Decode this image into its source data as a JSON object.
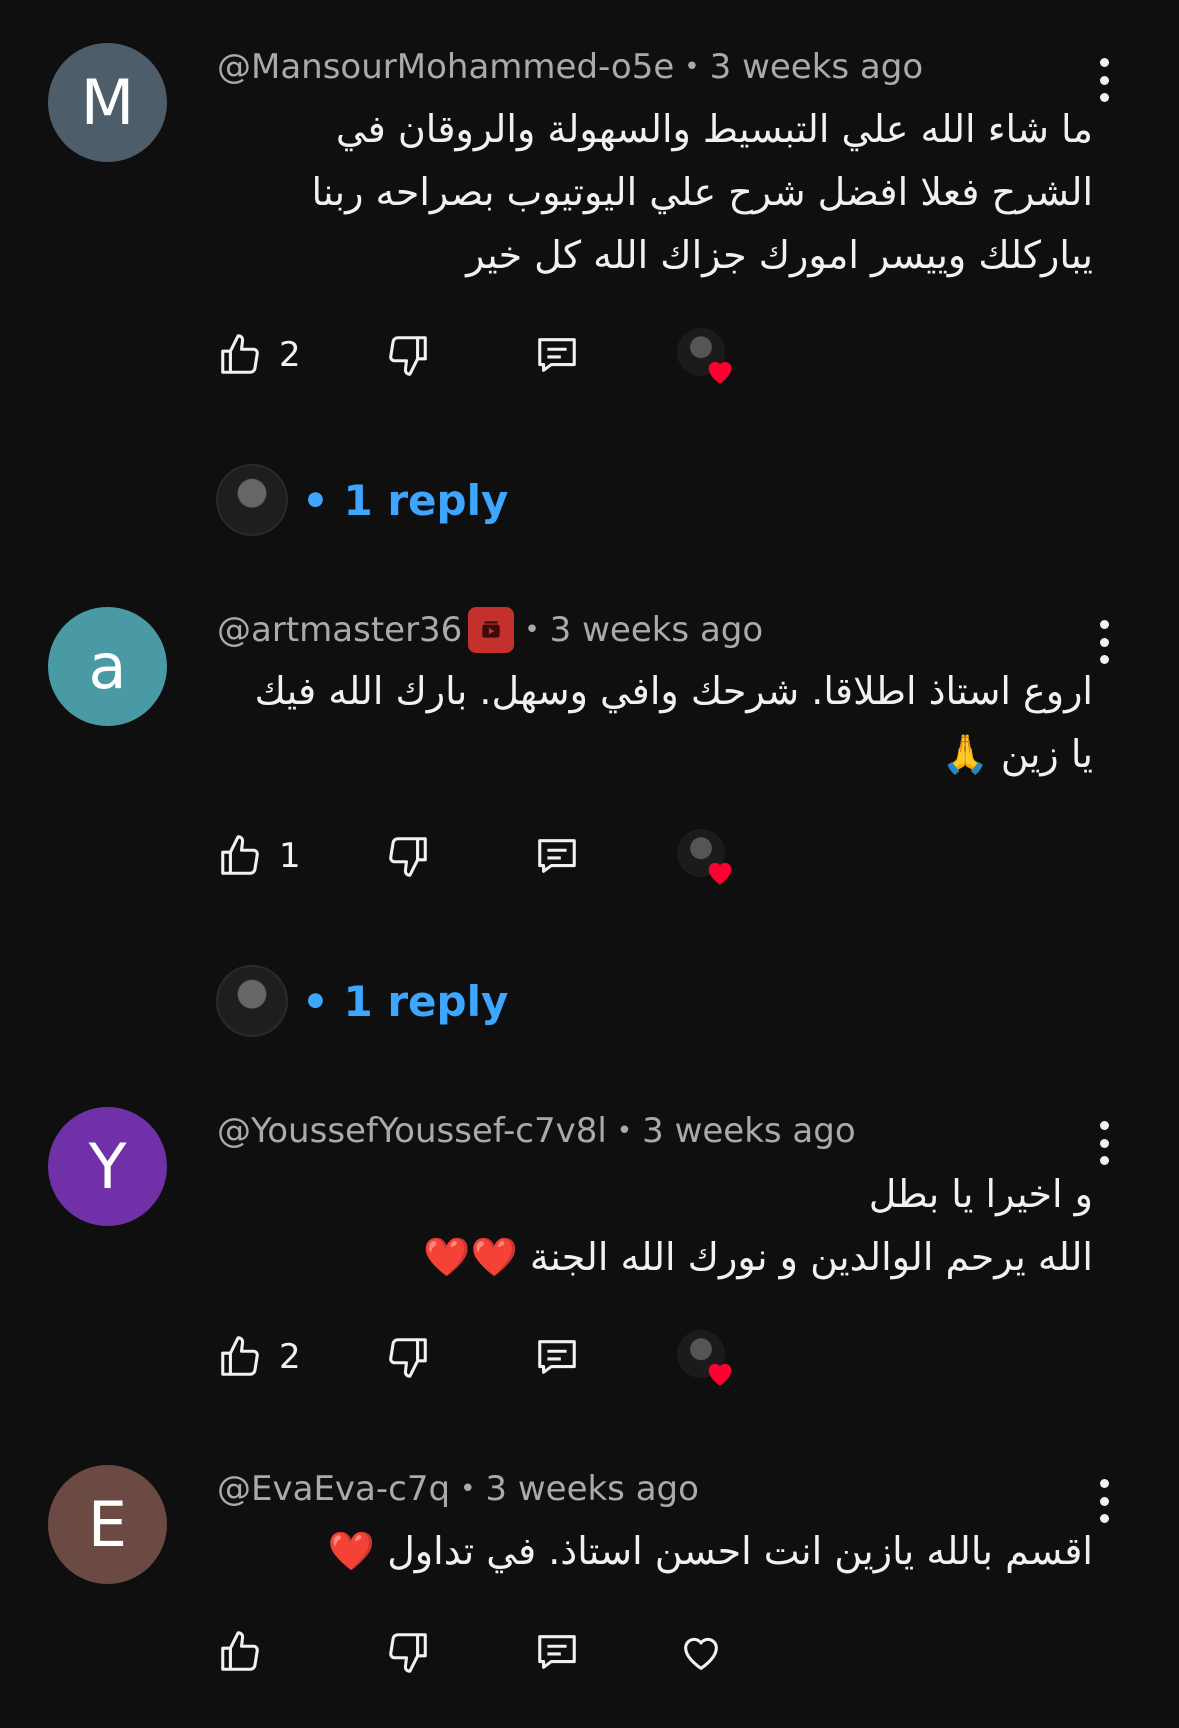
{
  "comments": [
    {
      "avatar_letter": "M",
      "avatar_color": "#4e5d6a",
      "author": "@MansourMohammed-o5e",
      "separator": "•",
      "time": "3 weeks ago",
      "lines": [
        "ما شاء الله علي التبسيط والسهولة والروقان في",
        "الشرح فعلا افضل شرح علي اليوتيوب بصراحه ربنا",
        "يباركلك وييسر امورك جزاك الله كل خير"
      ],
      "likes": "2",
      "hearted": true,
      "reply_label": "1 reply",
      "reply_dot": "•"
    },
    {
      "avatar_letter": "a",
      "avatar_color": "#4a9aa6",
      "author": "@artmaster36",
      "separator": "•",
      "time": "3 weeks ago",
      "lines": [
        "اروع استاذ اطلاقا. شرحك وافي وسهل. بارك الله فيك",
        "يا زين 🙏"
      ],
      "likes": "1",
      "hearted": true,
      "reply_label": "1 reply",
      "reply_dot": "•"
    },
    {
      "avatar_letter": "Y",
      "avatar_color": "#7030a8",
      "author": "@YoussefYoussef-c7v8l",
      "separator": "•",
      "time": "3 weeks ago",
      "lines": [
        "و اخيرا يا بطل",
        "الله يرحم الوالدين و نورك الله الجنة ❤️❤️"
      ],
      "likes": "2",
      "hearted": true
    },
    {
      "avatar_letter": "E",
      "avatar_color": "#6b4a44",
      "author": "@EvaEva-c7q",
      "separator": "•",
      "time": "3 weeks ago",
      "lines": [
        "اقسم بالله يازين انت احسن استاذ. في تداول ❤️"
      ],
      "likes": "",
      "hearted": false
    }
  ],
  "icons": {
    "like": "thumb-up-icon",
    "dislike": "thumb-down-icon",
    "reply": "comment-reply-icon",
    "heart": "heart-icon",
    "more": "more-vertical-icon"
  },
  "colors": {
    "background": "#0f0f0f",
    "link": "#3ea6ff",
    "heart": "#ff0033",
    "meta": "#aaaaaa"
  }
}
